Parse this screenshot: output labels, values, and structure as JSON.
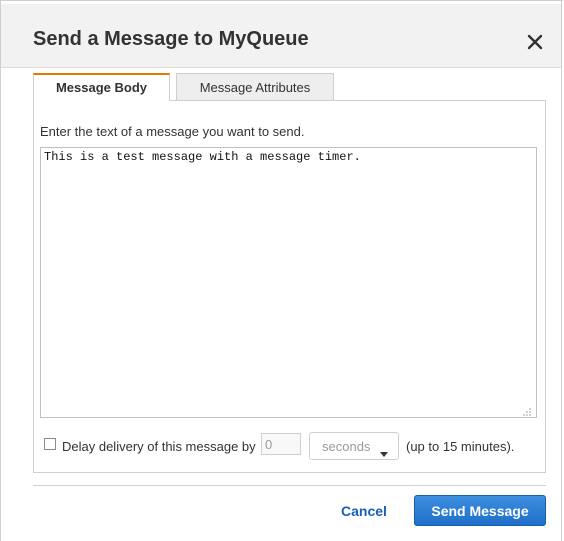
{
  "dialog": {
    "title": "Send a Message to MyQueue",
    "close_icon": "close-icon"
  },
  "tabs": [
    {
      "label": "Message Body",
      "active": true
    },
    {
      "label": "Message Attributes",
      "active": false
    }
  ],
  "body": {
    "instruction": "Enter the text of a message you want to send.",
    "message": "This is a test message with a message timer."
  },
  "delay": {
    "checkbox_checked": false,
    "label": "Delay delivery of this message by",
    "value": "0",
    "unit": "seconds",
    "hint": "(up to 15 minutes)."
  },
  "footer": {
    "cancel_label": "Cancel",
    "send_label": "Send Message"
  },
  "colors": {
    "accent_tab": "#e07b00",
    "primary_button": "#1f6fc9",
    "link": "#1a5fb4"
  }
}
